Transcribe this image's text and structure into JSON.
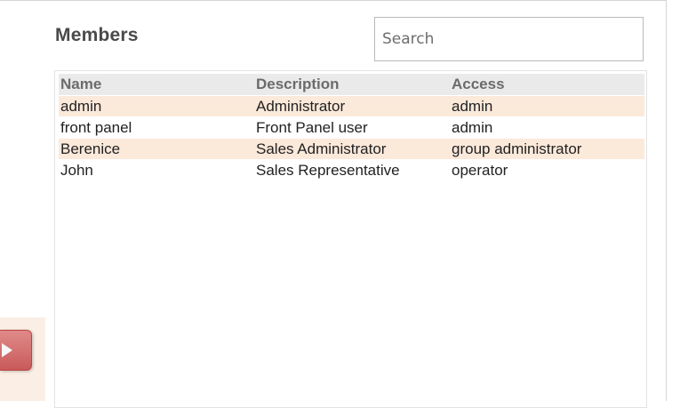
{
  "members": {
    "title": "Members",
    "search_placeholder": "Search",
    "columns": [
      "Name",
      "Description",
      "Access"
    ],
    "rows": [
      {
        "name": "admin",
        "description": "Administrator",
        "access": "admin"
      },
      {
        "name": "front panel",
        "description": "Front Panel user",
        "access": "admin"
      },
      {
        "name": "Berenice",
        "description": "Sales Administrator",
        "access": "group administrator"
      },
      {
        "name": "John",
        "description": "Sales Representative",
        "access": "operator"
      }
    ]
  },
  "left_panel": {
    "expand_icon": "play-triangle-icon"
  }
}
